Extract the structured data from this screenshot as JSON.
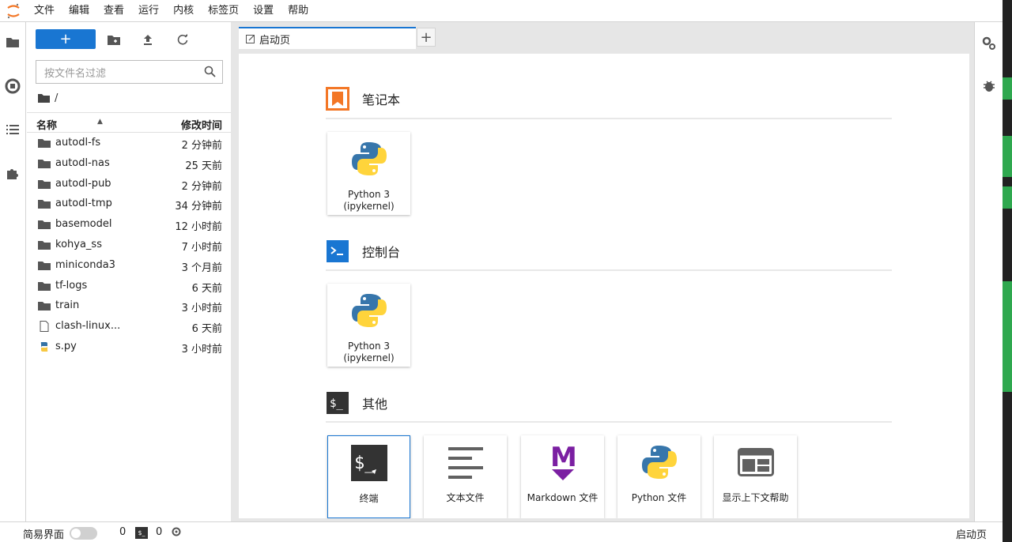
{
  "menu": [
    "文件",
    "编辑",
    "查看",
    "运行",
    "内核",
    "标签页",
    "设置",
    "帮助"
  ],
  "filebrowser": {
    "new_label": "+",
    "filter_placeholder": "按文件名过滤",
    "path": "/",
    "col_name": "名称",
    "col_modified": "修改时间",
    "rows": [
      {
        "name": "autodl-fs",
        "time": "2 分钟前",
        "kind": "folder"
      },
      {
        "name": "autodl-nas",
        "time": "25 天前",
        "kind": "folder"
      },
      {
        "name": "autodl-pub",
        "time": "2 分钟前",
        "kind": "folder"
      },
      {
        "name": "autodl-tmp",
        "time": "34 分钟前",
        "kind": "folder"
      },
      {
        "name": "basemodel",
        "time": "12 小时前",
        "kind": "folder"
      },
      {
        "name": "kohya_ss",
        "time": "7 小时前",
        "kind": "folder"
      },
      {
        "name": "miniconda3",
        "time": "3 个月前",
        "kind": "folder"
      },
      {
        "name": "tf-logs",
        "time": "6 天前",
        "kind": "folder"
      },
      {
        "name": "train",
        "time": "3 小时前",
        "kind": "folder"
      },
      {
        "name": "clash-linux...",
        "time": "6 天前",
        "kind": "file"
      },
      {
        "name": "s.py",
        "time": "3 小时前",
        "kind": "python"
      }
    ]
  },
  "tabs": {
    "launcher_label": "启动页",
    "add_label": "+"
  },
  "launcher": {
    "notebook": {
      "title": "笔记本",
      "cards": [
        {
          "label": "Python 3\n(ipykernel)"
        }
      ]
    },
    "console": {
      "title": "控制台",
      "cards": [
        {
          "label": "Python 3\n(ipykernel)"
        }
      ]
    },
    "other": {
      "title": "其他",
      "cards": [
        {
          "label": "终端"
        },
        {
          "label": "文本文件"
        },
        {
          "label": "Markdown 文件"
        },
        {
          "label": "Python 文件"
        },
        {
          "label": "显示上下文帮助"
        }
      ]
    }
  },
  "statusbar": {
    "simple_mode": "简易界面",
    "kernels": "0",
    "terminals": "0",
    "right": "启动页"
  },
  "colors": {
    "accent": "#1976d2",
    "notebook_icon": "#f37726",
    "console_icon": "#1976d2",
    "markdown": "#7b1fa2"
  }
}
